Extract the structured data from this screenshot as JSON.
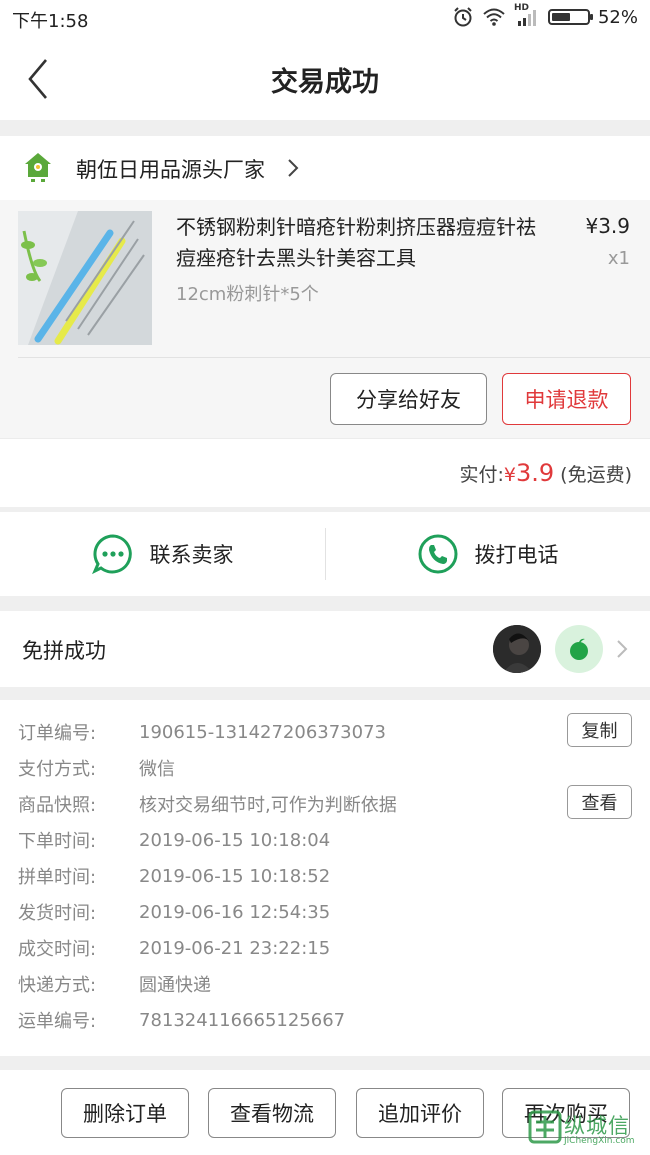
{
  "status_bar": {
    "time": "下午1:58",
    "network": "HD",
    "battery": "52%",
    "battery_level": 0.52
  },
  "nav": {
    "title": "交易成功"
  },
  "shop": {
    "name": "朝伍日用品源头厂家"
  },
  "product": {
    "title": "不锈钢粉刺针暗疮针粉刺挤压器痘痘针祛痘痤疮针去黑头针美容工具",
    "spec": "12cm粉刺针*5个",
    "price": "¥3.9",
    "qty": "x1",
    "share_label": "分享给好友",
    "refund_label": "申请退款"
  },
  "payment": {
    "label": "实付:",
    "currency": "¥",
    "amount": "3.9",
    "note": " (免运费)"
  },
  "contact": {
    "seller_label": "联系卖家",
    "phone_label": "拨打电话"
  },
  "group": {
    "title": "免拼成功"
  },
  "order_info": {
    "rows": [
      {
        "label": "订单编号:",
        "value": "190615-131427206373073"
      },
      {
        "label": "支付方式:",
        "value": "微信"
      },
      {
        "label": "商品快照:",
        "value": "核对交易细节时,可作为判断依据"
      },
      {
        "label": "下单时间:",
        "value": "2019-06-15 10:18:04"
      },
      {
        "label": "拼单时间:",
        "value": "2019-06-15 10:18:52"
      },
      {
        "label": "发货时间:",
        "value": "2019-06-16 12:54:35"
      },
      {
        "label": "成交时间:",
        "value": "2019-06-21 23:22:15"
      },
      {
        "label": "快递方式:",
        "value": "圆通快递"
      },
      {
        "label": "运单编号:",
        "value": "781324116665125667"
      }
    ],
    "copy_label": "复制",
    "view_label": "查看"
  },
  "actions": {
    "delete": "删除订单",
    "logistics": "查看物流",
    "review": "追加评价",
    "rebuy": "再次购买"
  },
  "watermark": {
    "text": "纵城信",
    "url": "JiChengXin.com"
  },
  "colors": {
    "accent_red": "#e0393b",
    "contact_green": "#1fa05a",
    "shop_green": "#5aa83a"
  }
}
